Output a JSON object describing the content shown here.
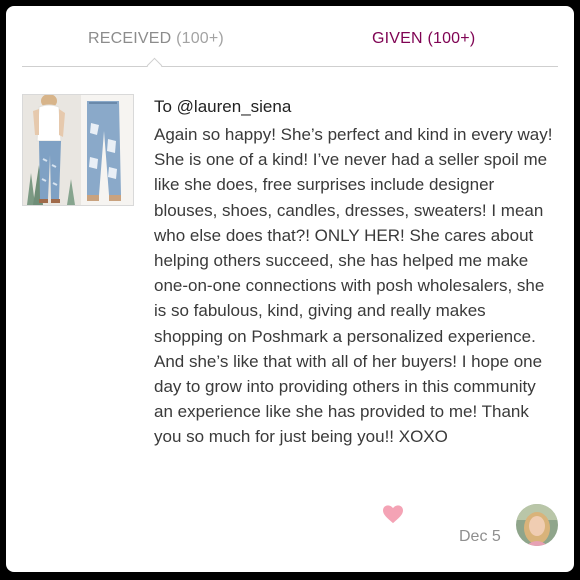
{
  "tabs": {
    "received": {
      "label": "RECEIVED",
      "count": "(100+)"
    },
    "given": {
      "label": "GIVEN",
      "count": "(100+)"
    }
  },
  "review": {
    "recipient": "To @lauren_siena",
    "body": "Again so happy! She’s perfect and kind in every way! She is one of a kind! I’ve never had a seller spoil me like she does, free surprises include designer blouses, shoes, candles, dresses, sweaters! I mean who else does that?! ONLY HER! She cares about helping others succeed, she has helped me make one-on-one connections with posh wholesalers, she is so fabulous, kind, giving and really makes shopping on Poshmark a personalized experience. And she’s like that with all of her buyers! I hope one day to grow into providing others in this community an experience like she has provided to me! Thank you so much for just being you!! XOXO",
    "date": "Dec 5"
  },
  "icons": {
    "like": "heart-icon"
  },
  "colors": {
    "active_tab": "#7f0353",
    "inactive_tab": "#8c8c8c",
    "heart": "#f4a3b5"
  }
}
